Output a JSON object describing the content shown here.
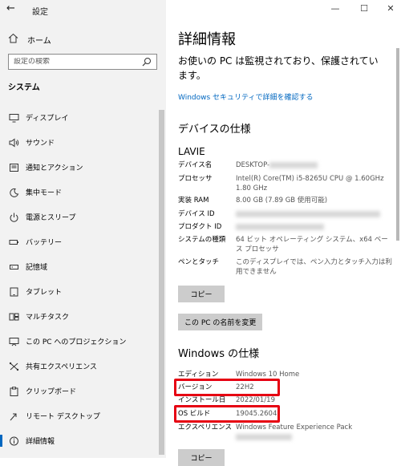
{
  "window": {
    "title": "設定",
    "back_icon": "arrow-left-icon",
    "controls": [
      "—",
      "☐",
      "✕"
    ]
  },
  "sidebar": {
    "home_label": "ホーム",
    "search_placeholder": "設定の検索",
    "section_title": "システム",
    "items": [
      {
        "label": "ディスプレイ",
        "icon": "display-icon"
      },
      {
        "label": "サウンド",
        "icon": "speaker-icon"
      },
      {
        "label": "通知とアクション",
        "icon": "notification-icon"
      },
      {
        "label": "集中モード",
        "icon": "moon-icon"
      },
      {
        "label": "電源とスリープ",
        "icon": "power-icon"
      },
      {
        "label": "バッテリー",
        "icon": "battery-icon"
      },
      {
        "label": "記憶域",
        "icon": "storage-icon"
      },
      {
        "label": "タブレット",
        "icon": "tablet-icon"
      },
      {
        "label": "マルチタスク",
        "icon": "multitask-icon"
      },
      {
        "label": "この PC へのプロジェクション",
        "icon": "projection-icon"
      },
      {
        "label": "共有エクスペリエンス",
        "icon": "share-icon"
      },
      {
        "label": "クリップボード",
        "icon": "clipboard-icon"
      },
      {
        "label": "リモート デスクトップ",
        "icon": "remote-icon"
      },
      {
        "label": "詳細情報",
        "icon": "info-icon",
        "active": true
      }
    ]
  },
  "main": {
    "title": "詳細情報",
    "protect_text": "お使いの PC は監視されており、保護されています。",
    "security_link": "Windows セキュリティで詳細を確認する",
    "device_spec_title": "デバイスの仕様",
    "device_model": "LAVIE",
    "device_specs": [
      {
        "key": "デバイス名",
        "value": "DESKTOP-"
      },
      {
        "key": "プロセッサ",
        "value": "Intel(R) Core(TM) i5-8265U CPU @ 1.60GHz 1.80 GHz"
      },
      {
        "key": "実装 RAM",
        "value": "8.00 GB (7.89 GB 使用可能)"
      },
      {
        "key": "デバイス ID",
        "value": ""
      },
      {
        "key": "プロダクト ID",
        "value": ""
      },
      {
        "key": "システムの種類",
        "value": "64 ビット オペレーティング システム、x64 ベース プロセッサ"
      },
      {
        "key": "ペンとタッチ",
        "value": "このディスプレイでは、ペン入力とタッチ入力は利用できません"
      }
    ],
    "copy_button": "コピー",
    "rename_button": "この PC の名前を変更",
    "windows_spec_title": "Windows の仕様",
    "windows_specs": [
      {
        "key": "エディション",
        "value": "Windows 10 Home"
      },
      {
        "key": "バージョン",
        "value": "22H2"
      },
      {
        "key": "インストール日",
        "value": "2022/01/19"
      },
      {
        "key": "OS ビルド",
        "value": "19045.2604"
      },
      {
        "key": "エクスペリエンス",
        "value": "Windows Feature Experience Pack"
      }
    ],
    "copy_button_2": "コピー"
  }
}
